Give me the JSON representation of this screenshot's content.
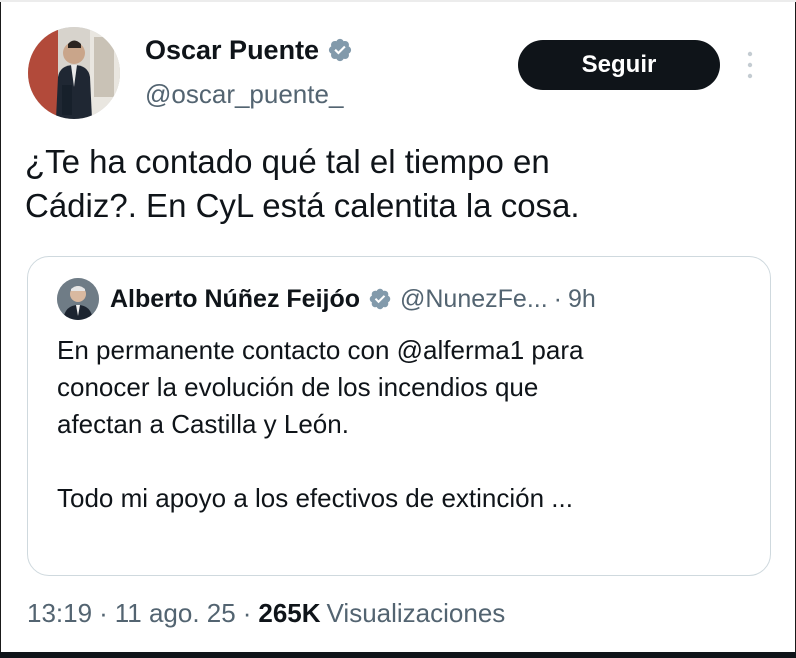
{
  "tweet": {
    "author": {
      "display_name": "Oscar Puente",
      "handle": "@oscar_puente_",
      "verified_icon": "verified-badge-icon"
    },
    "follow_label": "Seguir",
    "more_icon": "more-vertical-icon",
    "text_line1": "¿Te ha contado qué tal el tiempo en",
    "text_line2": "Cádiz?. En CyL está calentita la cosa.",
    "time": "13:19",
    "date": "11 ago. 25",
    "separator": "·",
    "view_count": "265K",
    "views_label": "Visualizaciones"
  },
  "quoted": {
    "display_name": "Alberto Núñez Feijóo",
    "handle": "@NunezFe...",
    "separator": "·",
    "age": "9h",
    "line1": "En permanente contacto con @alferma1 para",
    "line2": "conocer la evolución de los incendios que",
    "line3": "afectan a Castilla y León.",
    "line4": "Todo mi apoyo a los efectivos de extinción ..."
  },
  "colors": {
    "text_primary": "#0f1419",
    "text_secondary": "#536471",
    "verified_badge": "#829aab",
    "border": "#cfd9de"
  }
}
